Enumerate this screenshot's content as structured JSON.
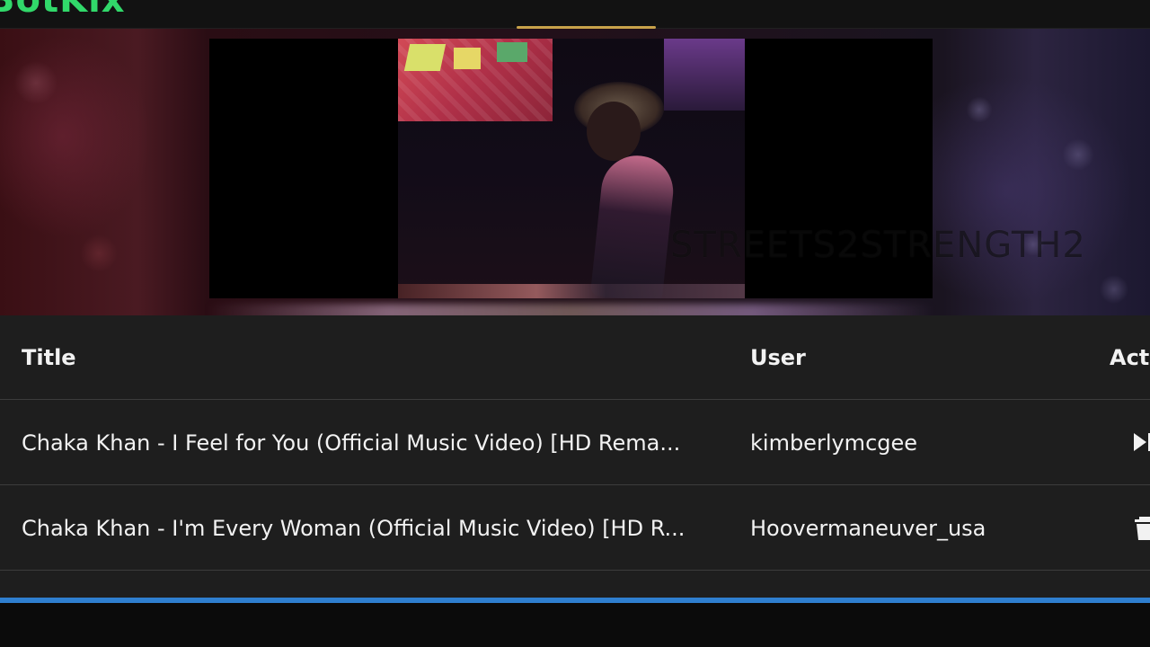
{
  "app": {
    "logo_text": "BotKix"
  },
  "player": {
    "watermark": "STREETS2STRENGTH2"
  },
  "queue": {
    "columns": {
      "title": "Title",
      "user": "User",
      "actions": "Acti"
    },
    "rows": [
      {
        "title": "Chaka Khan - I Feel for You (Official Music Video) [HD Rema...",
        "user": "kimberlymcgee",
        "action_icon": "play-next-icon"
      },
      {
        "title": "Chaka Khan - I'm Every Woman (Official Music Video) [HD R...",
        "user": "Hoovermaneuver_usa",
        "action_icon": "trash-icon"
      }
    ]
  },
  "colors": {
    "accent": "#31d86a",
    "progress": "#2f7fcf",
    "table_bg": "#1e1e1e"
  }
}
